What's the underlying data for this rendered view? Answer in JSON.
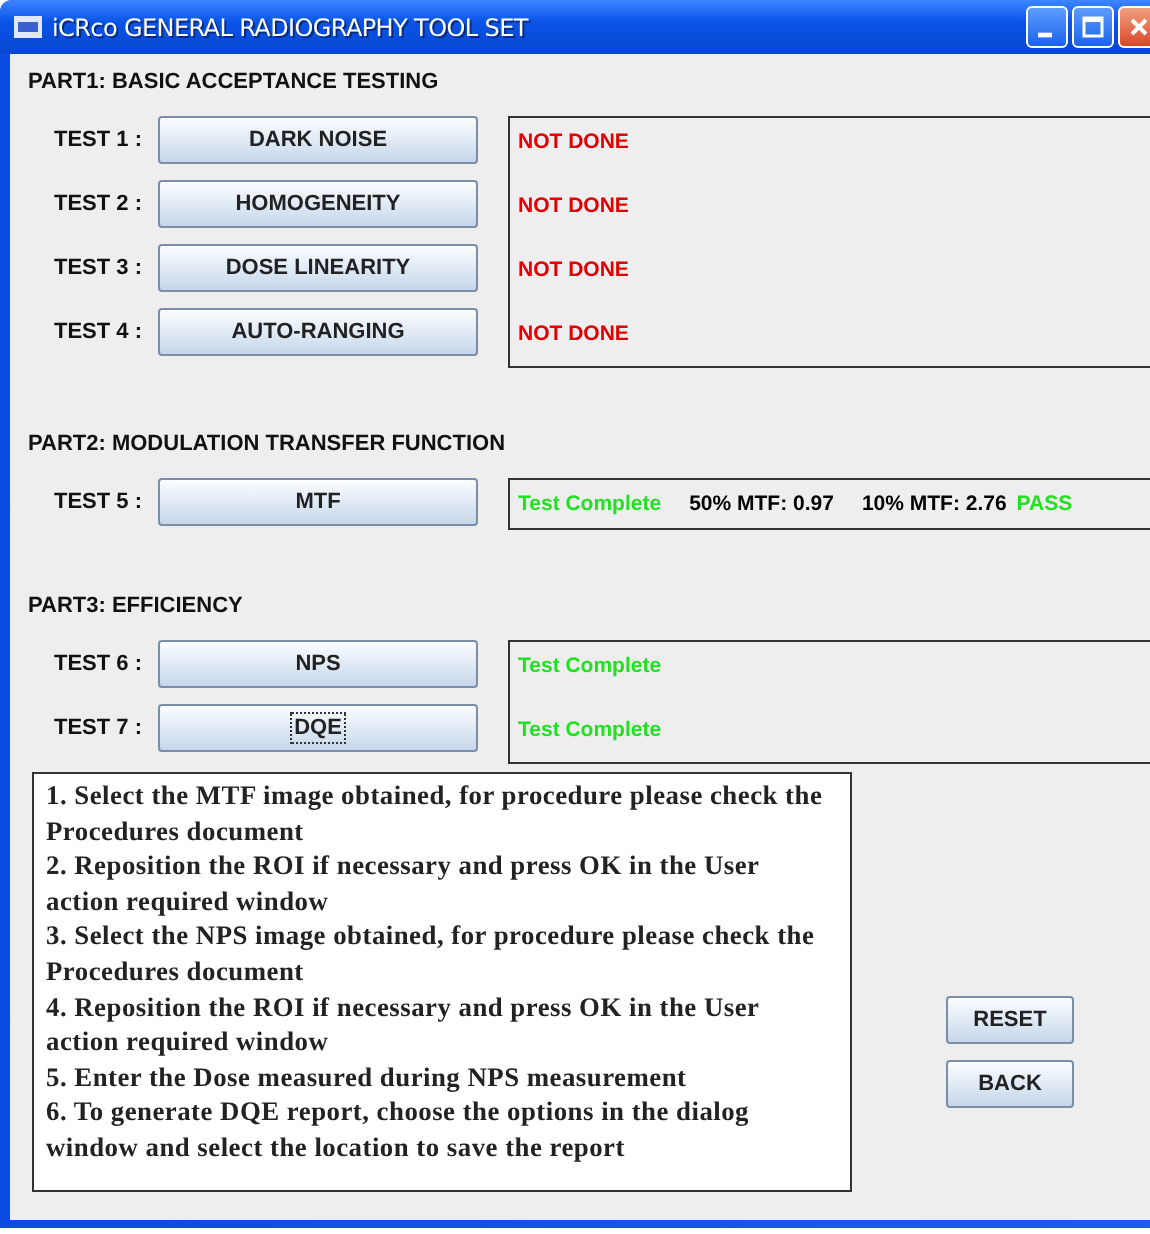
{
  "window": {
    "title": "iCRco GENERAL RADIOGRAPHY TOOL SET"
  },
  "parts": [
    {
      "title": "PART1: BASIC ACCEPTANCE TESTING",
      "tests": [
        {
          "label": "TEST 1 :",
          "button": "DARK NOISE",
          "result": [
            {
              "text": "NOT DONE",
              "color": "#e00000"
            }
          ]
        },
        {
          "label": "TEST 2 :",
          "button": "HOMOGENEITY",
          "result": [
            {
              "text": "NOT DONE",
              "color": "#e00000"
            }
          ]
        },
        {
          "label": "TEST 3 :",
          "button": "DOSE LINEARITY",
          "result": [
            {
              "text": "NOT DONE",
              "color": "#e00000"
            }
          ]
        },
        {
          "label": "TEST 4 :",
          "button": "AUTO-RANGING",
          "result": [
            {
              "text": "NOT DONE",
              "color": "#e00000"
            }
          ]
        }
      ]
    },
    {
      "title": "PART2: MODULATION TRANSFER FUNCTION",
      "tests": [
        {
          "label": "TEST 5 :",
          "button": "MTF",
          "result": [
            {
              "text": "Test Complete",
              "color": "#22e022"
            },
            {
              "text": "50% MTF: 0.97",
              "color": "#000000"
            },
            {
              "text": "10% MTF: 2.76",
              "color": "#000000"
            },
            {
              "text": "PASS",
              "color": "#22e022"
            }
          ]
        }
      ]
    },
    {
      "title": "PART3: EFFICIENCY",
      "tests": [
        {
          "label": "TEST 6 :",
          "button": "NPS",
          "result": [
            {
              "text": "Test Complete",
              "color": "#22e022"
            }
          ]
        },
        {
          "label": "TEST 7 :",
          "button": "DQE",
          "focused": true,
          "result": [
            {
              "text": "Test Complete",
              "color": "#22e022"
            }
          ]
        }
      ]
    }
  ],
  "instructions": [
    "1. Select the MTF image obtained, for procedure please check the Procedures document",
    "2. Reposition the ROI if necessary and press OK in the User action required window",
    "3. Select the NPS image obtained, for procedure please check the Procedures document",
    "4. Reposition the ROI if necessary and press OK in the User action required window",
    "5. Enter the Dose measured during NPS measurement",
    "6. To generate DQE report, choose the options in the dialog window and select the location to save the report"
  ],
  "buttons": [
    "RESET",
    "BACK"
  ]
}
